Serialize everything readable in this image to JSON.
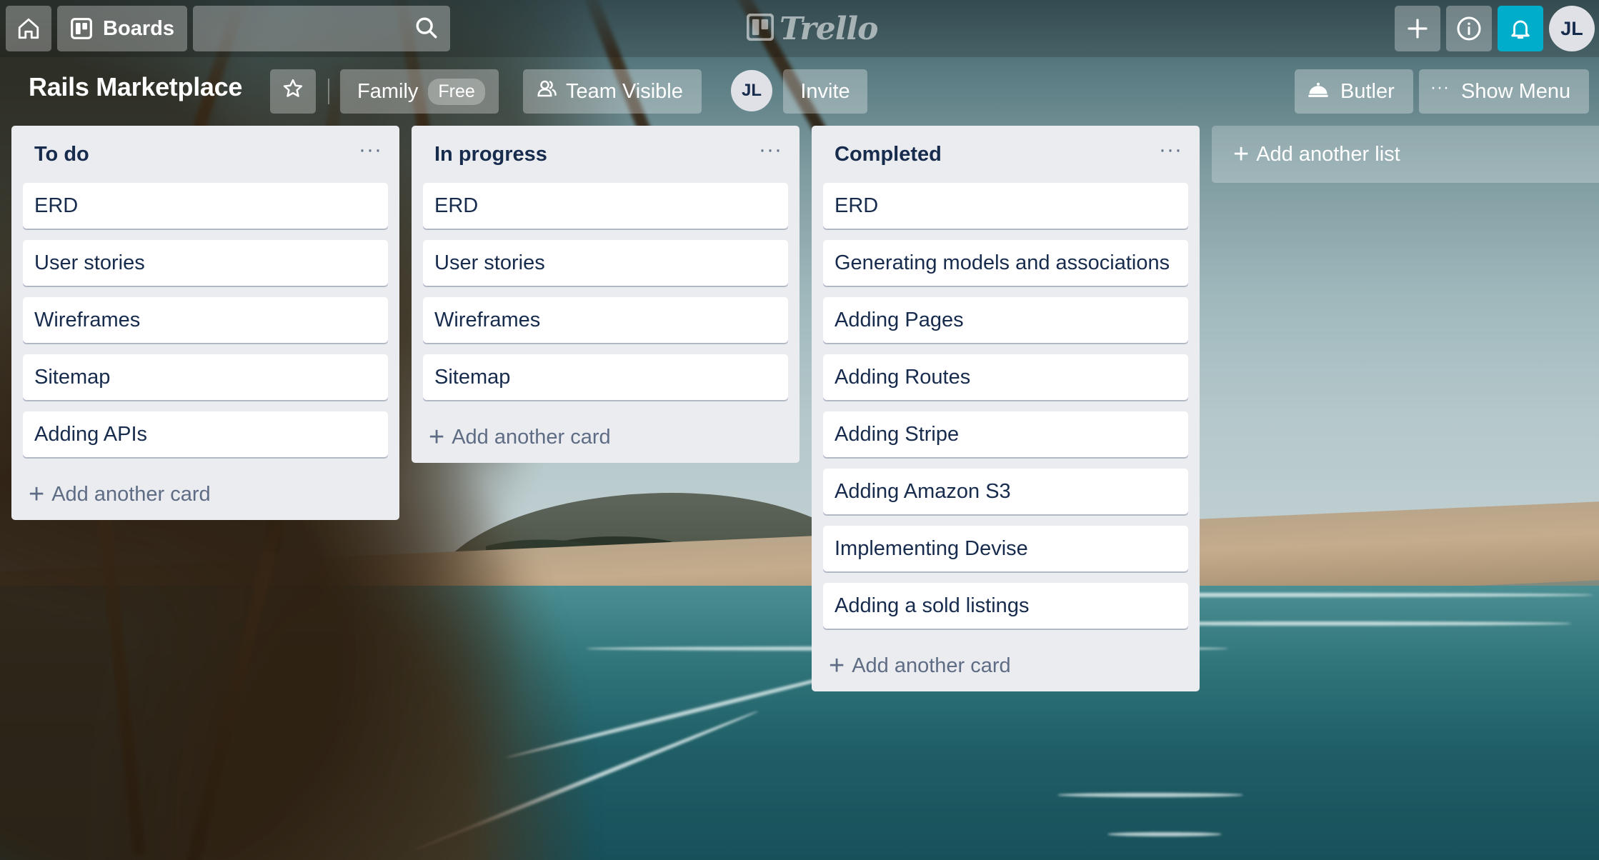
{
  "header": {
    "boards_label": "Boards",
    "search_placeholder": "",
    "logo_text": "Trello",
    "user_initials": "JL"
  },
  "board": {
    "title": "Rails Marketplace",
    "team_label": "Family",
    "plan_badge": "Free",
    "visibility_label": "Team Visible",
    "member_initials": "JL",
    "invite_label": "Invite",
    "butler_label": "Butler",
    "show_menu_label": "Show Menu"
  },
  "lists": [
    {
      "title": "To do",
      "menu": "···",
      "cards": [
        "ERD",
        "User stories",
        "Wireframes",
        "Sitemap",
        "Adding APIs"
      ],
      "add_card_label": "Add another card"
    },
    {
      "title": "In progress",
      "menu": "···",
      "cards": [
        "ERD",
        "User stories",
        "Wireframes",
        "Sitemap"
      ],
      "add_card_label": "Add another card"
    },
    {
      "title": "Completed",
      "menu": "···",
      "cards": [
        "ERD",
        "Generating models and associations",
        "Adding Pages",
        "Adding Routes",
        "Adding Stripe",
        "Adding Amazon S3",
        "Implementing Devise",
        "Adding a sold listings"
      ],
      "add_card_label": "Add another card"
    }
  ],
  "add_list_label": "Add another list",
  "colors": {
    "list_bg": "#ebecf0",
    "card_text": "#172b4d",
    "muted_text": "#5e6c84",
    "notification_accent": "#00aecc"
  },
  "icons": [
    "home-icon",
    "board-icon",
    "search-icon",
    "plus-icon",
    "info-icon",
    "bell-icon",
    "star-icon",
    "team-visible-icon",
    "butler-icon",
    "more-icon"
  ]
}
